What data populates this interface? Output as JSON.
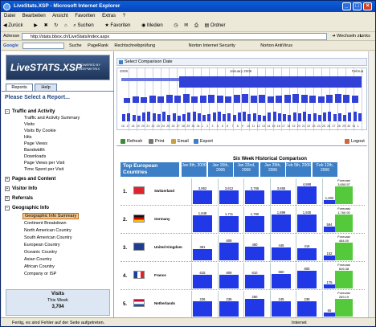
{
  "window": {
    "title": "LiveStats.XSP - Microsoft Internet Explorer"
  },
  "menu": [
    "Datei",
    "Bearbeiten",
    "Ansicht",
    "Favoriten",
    "Extras",
    "?"
  ],
  "toolbar": {
    "back": "Zurück",
    "search": "Suchen",
    "favorites": "Favoriten",
    "media": "Medien",
    "folder": "Ordner"
  },
  "address": {
    "label": "Adresse",
    "url": "http://stats.bbox.ch/LiveStats/index.aspx",
    "go": "Wechseln zu",
    "links": "Links"
  },
  "google": {
    "label": "Google",
    "search": "Suche",
    "pagerank": "PageRank",
    "spell": "Rechtschreibprüfung",
    "nis": "Norton Internet Security",
    "av": "Norton AntiVirus"
  },
  "logo": {
    "title": "LiveSTATS.XSP",
    "sub": "POWERED BY DEEPMETRIX"
  },
  "tabs": [
    "Reports",
    "Help"
  ],
  "select_heading": "Please Select a Report...",
  "tree": [
    {
      "label": "Traffic and Activity",
      "items": [
        "Traffic and Activity Summary",
        "Visits",
        "Visits By Cookie",
        "Hits",
        "Page Views",
        "Bandwidth",
        "Downloads",
        "Page Views per Visit",
        "Time Spent per Visit"
      ]
    },
    {
      "label": "Pages and Content",
      "items": []
    },
    {
      "label": "Visitor Info",
      "items": []
    },
    {
      "label": "Referrals",
      "items": []
    },
    {
      "label": "Geographic Info",
      "items": [
        "Geographic Info Summary",
        "Continent Breakdown",
        "North American Country",
        "South American Country",
        "European Country",
        "Oceanic Country",
        "Asian Country",
        "African Country",
        "Company or ISP"
      ]
    }
  ],
  "visits_box": {
    "title": "Visits",
    "period": "This Week",
    "value": "3,704"
  },
  "timeline": {
    "header": "Select Comparison Date",
    "year_label": "2005",
    "month_label": "January 2006",
    "right_label": "Februa"
  },
  "actions": {
    "refresh": "Refresh",
    "print": "Print",
    "email": "Email",
    "export": "Export",
    "logout": "Logout"
  },
  "chart_data": {
    "type": "bar",
    "title": "Six Week Historical Comparison",
    "header_first": "Top European Countries",
    "categories": [
      "Jan 8th, 2006",
      "Jan 15th, 2006",
      "Jan 22nd, 2006",
      "Jan 29th, 2006",
      "Feb 5th, 2006",
      "Feb 12th, 2006"
    ],
    "forecast_label": "Forecast",
    "series": [
      {
        "rank": "1.",
        "name": "Switzerland",
        "values": [
          3862,
          3812,
          3765,
          3665,
          4868,
          1202
        ],
        "forecast": "3,650.57"
      },
      {
        "rank": "2.",
        "name": "Germany",
        "values": [
          1848,
          1711,
          1760,
          1899,
          1930,
          584
        ],
        "forecast": "1,760.92"
      },
      {
        "rank": "3.",
        "name": "United Kingdom",
        "values": [
          381,
          608,
          480,
          448,
          416,
          152
        ],
        "forecast": "484.00"
      },
      {
        "rank": "4.",
        "name": "France",
        "values": [
          615,
          609,
          610,
          660,
          805,
          175
        ],
        "forecast": "626.38"
      },
      {
        "rank": "5.",
        "name": "Netherlands",
        "values": [
          236,
          236,
          280,
          245,
          238,
          65
        ],
        "forecast": "269.19"
      }
    ],
    "display_values": [
      [
        "3,862",
        "3,812",
        "3,765",
        "3,665",
        "4,868",
        "1,202"
      ],
      [
        "1,848",
        "1,711",
        "1,760",
        "1,899",
        "1,930",
        "584"
      ],
      [
        "381",
        "608",
        "480",
        "448",
        "416",
        "152"
      ],
      [
        "615",
        "609",
        "610",
        "660",
        "805",
        "175"
      ],
      [
        "236",
        "236",
        "280",
        "245",
        "238",
        "65"
      ]
    ]
  },
  "status": {
    "text": "Fertig, es sind Fehler auf der Seite aufgetreten.",
    "zone": "Internet"
  }
}
